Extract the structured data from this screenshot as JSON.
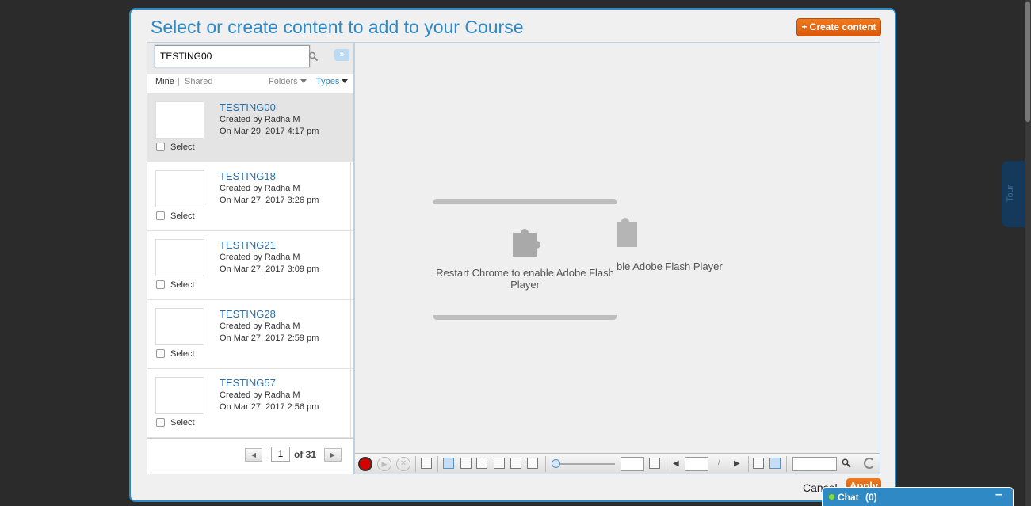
{
  "modal": {
    "title": "Select or create content to add to your Course",
    "create_button": "+ Create content"
  },
  "search": {
    "value": "TESTING00",
    "expand_label": "»"
  },
  "filters": {
    "mine": "Mine",
    "separator": "|",
    "shared": "Shared",
    "folders": "Folders",
    "types": "Types"
  },
  "items": [
    {
      "name": "TESTING00",
      "created": "Created by Radha M",
      "date": "On Mar 29, 2017 4:17 pm",
      "select": "Select",
      "selected": true
    },
    {
      "name": "TESTING18",
      "created": "Created by Radha M",
      "date": "On Mar 27, 2017 3:26 pm",
      "select": "Select",
      "selected": false
    },
    {
      "name": "TESTING21",
      "created": "Created by Radha M",
      "date": "On Mar 27, 2017 3:09 pm",
      "select": "Select",
      "selected": false
    },
    {
      "name": "TESTING28",
      "created": "Created by Radha M",
      "date": "On Mar 27, 2017 2:59 pm",
      "select": "Select",
      "selected": false
    },
    {
      "name": "TESTING57",
      "created": "Created by Radha M",
      "date": "On Mar 27, 2017 2:56 pm",
      "select": "Select",
      "selected": false
    }
  ],
  "pager": {
    "current_page": "1",
    "of_label": "of 31",
    "prev": "◀",
    "next": "▶"
  },
  "preview": {
    "flash_message": "Restart Chrome to enable Adobe Flash Player",
    "ghost_message": "ble Adobe Flash Player"
  },
  "footer": {
    "cancel": "Cancel",
    "apply": "Apply"
  },
  "sidebar_tab": {
    "tour": "Tour"
  },
  "chat": {
    "label": "Chat",
    "count": "(0)",
    "minimize": "–"
  },
  "colors": {
    "accent": "#2e89c5",
    "orange": "#e8680f",
    "backdrop": "#2b2b2b"
  },
  "icons": [
    "search-icon",
    "expand-icon",
    "puzzle-icon",
    "record-icon",
    "play-icon",
    "stop-icon",
    "print-icon",
    "monitor-icon",
    "magnifier-icon",
    "spinner-icon"
  ]
}
